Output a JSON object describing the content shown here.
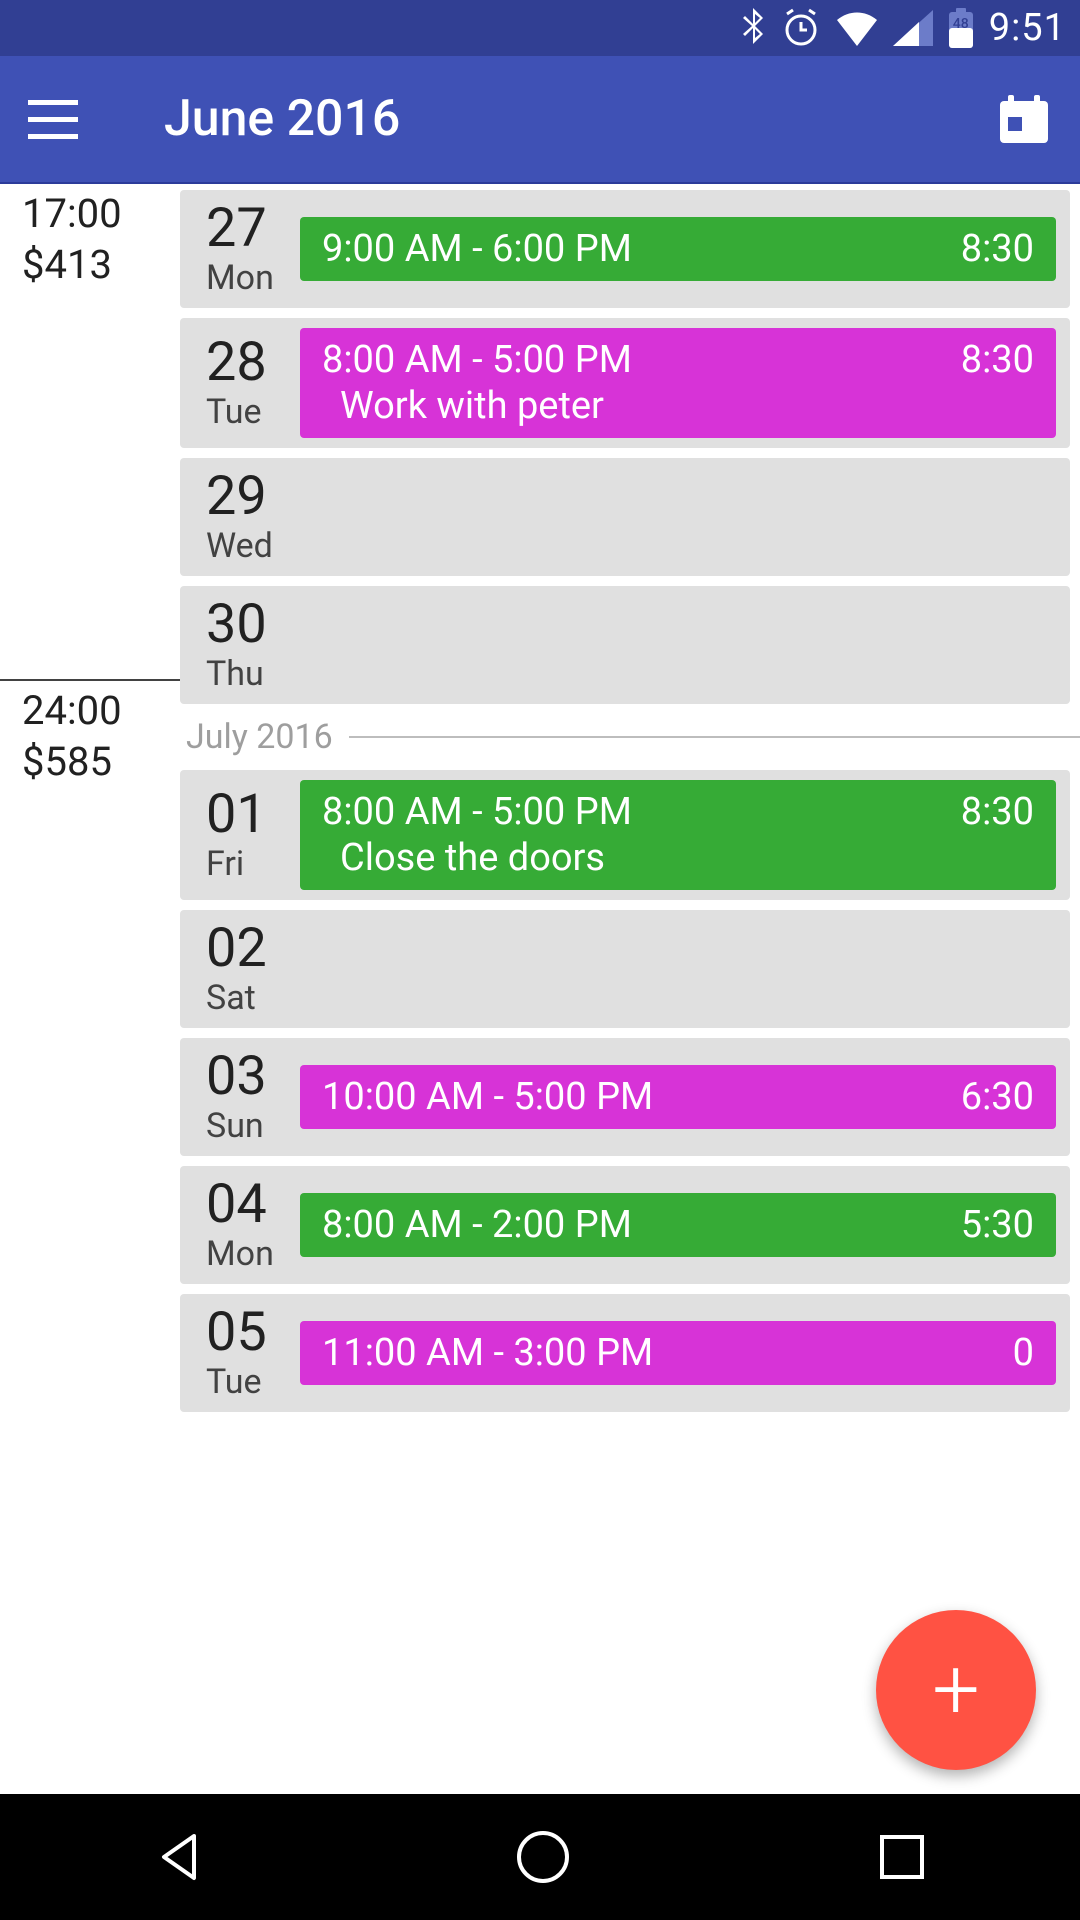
{
  "status": {
    "time": "9:51",
    "battery_label": "48"
  },
  "appbar": {
    "title": "June 2016"
  },
  "summaries": [
    {
      "hours": "17:00",
      "amount": "$413"
    },
    {
      "hours": "24:00",
      "amount": "$585"
    }
  ],
  "section_label": "July 2016",
  "days_june": [
    {
      "num": "27",
      "dow": "Mon",
      "events": [
        {
          "color": "green",
          "time": "9:00 AM - 6:00 PM",
          "dur": "8:30",
          "note": ""
        }
      ]
    },
    {
      "num": "28",
      "dow": "Tue",
      "events": [
        {
          "color": "magenta",
          "time": "8:00 AM - 5:00 PM",
          "dur": "8:30",
          "note": "Work with peter"
        }
      ]
    },
    {
      "num": "29",
      "dow": "Wed",
      "events": []
    },
    {
      "num": "30",
      "dow": "Thu",
      "events": []
    }
  ],
  "days_july": [
    {
      "num": "01",
      "dow": "Fri",
      "events": [
        {
          "color": "green",
          "time": "8:00 AM - 5:00 PM",
          "dur": "8:30",
          "note": "Close the doors"
        }
      ]
    },
    {
      "num": "02",
      "dow": "Sat",
      "events": []
    },
    {
      "num": "03",
      "dow": "Sun",
      "events": [
        {
          "color": "magenta",
          "time": "10:00 AM - 5:00 PM",
          "dur": "6:30",
          "note": ""
        }
      ]
    },
    {
      "num": "04",
      "dow": "Mon",
      "events": [
        {
          "color": "green",
          "time": "8:00 AM - 2:00 PM",
          "dur": "5:30",
          "note": ""
        }
      ]
    },
    {
      "num": "05",
      "dow": "Tue",
      "events": [
        {
          "color": "magenta",
          "time": "11:00 AM - 3:00 PM",
          "dur": "0",
          "note": ""
        }
      ]
    }
  ]
}
